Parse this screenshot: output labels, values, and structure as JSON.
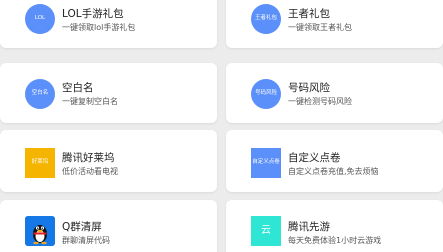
{
  "colors": {
    "blue": "#5b8ff9",
    "gold": "#f5b400",
    "qq_blue": "#1677e6",
    "teal": "#2ee6d3"
  },
  "cards": [
    {
      "title": "LOL手游礼包",
      "subtitle": "一键领取lol手游礼包",
      "icon_label": "LOL",
      "icon_name": "lol-icon",
      "icon_color": "#5b8ff9",
      "icon_shape": "circle"
    },
    {
      "title": "王者礼包",
      "subtitle": "一键领取王者礼包",
      "icon_label": "王者礼包",
      "icon_name": "honor-of-kings-icon",
      "icon_color": "#5b8ff9",
      "icon_shape": "circle"
    },
    {
      "title": "空白名",
      "subtitle": "一键复制空白名",
      "icon_label": "空白名",
      "icon_name": "blank-name-icon",
      "icon_color": "#5b8ff9",
      "icon_shape": "circle"
    },
    {
      "title": "号码风险",
      "subtitle": "一键检测号码风险",
      "icon_label": "号码风险",
      "icon_name": "number-risk-icon",
      "icon_color": "#5b8ff9",
      "icon_shape": "circle"
    },
    {
      "title": "腾讯好莱坞",
      "subtitle": "低价活动看电视",
      "icon_label": "好莱坞",
      "icon_name": "tencent-hollywood-icon",
      "icon_color": "#f5b400",
      "icon_shape": "square"
    },
    {
      "title": "自定义点卷",
      "subtitle": "自定义点卷充值,免去烦恼",
      "icon_label": "自定义点卷",
      "icon_name": "custom-points-icon",
      "icon_color": "#5b8ff9",
      "icon_shape": "square"
    },
    {
      "title": "Q群清屏",
      "subtitle": "群聊清屏代码",
      "icon_label": "",
      "icon_name": "qq-penguin-icon",
      "icon_color": "#1677e6",
      "icon_shape": "rounded"
    },
    {
      "title": "腾讯先游",
      "subtitle": "每天免费体验1小时云游戏",
      "icon_label": "云",
      "icon_name": "tencent-start-cloud-icon",
      "icon_color": "#2ee6d3",
      "icon_shape": "square"
    }
  ]
}
